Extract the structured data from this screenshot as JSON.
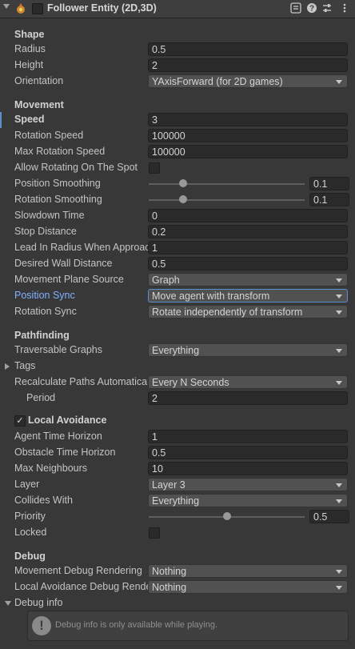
{
  "component": {
    "title": "Follower Entity (2D,3D)",
    "enabled": false
  },
  "sections": {
    "shape": "Shape",
    "movement": "Movement",
    "pathfinding": "Pathfinding",
    "local_avoidance": "Local Avoidance",
    "debug": "Debug"
  },
  "shape": {
    "radius": {
      "label": "Radius",
      "value": "0.5"
    },
    "height": {
      "label": "Height",
      "value": "2"
    },
    "orientation": {
      "label": "Orientation",
      "value": "YAxisForward (for 2D games)"
    }
  },
  "movement": {
    "speed": {
      "label": "Speed",
      "value": "3"
    },
    "rotation_speed": {
      "label": "Rotation Speed",
      "value": "100000"
    },
    "max_rotation_speed": {
      "label": "Max Rotation Speed",
      "value": "100000"
    },
    "allow_rotating": {
      "label": "Allow Rotating On The Spot",
      "checked": false
    },
    "position_smoothing": {
      "label": "Position Smoothing",
      "value": "0.1",
      "fraction": 0.22
    },
    "rotation_smoothing": {
      "label": "Rotation Smoothing",
      "value": "0.1",
      "fraction": 0.22
    },
    "slowdown_time": {
      "label": "Slowdown Time",
      "value": "0"
    },
    "stop_distance": {
      "label": "Stop Distance",
      "value": "0.2"
    },
    "lead_in_radius": {
      "label": "Lead In Radius When Approaching",
      "value": "1"
    },
    "desired_wall_distance": {
      "label": "Desired Wall Distance",
      "value": "0.5"
    },
    "movement_plane_source": {
      "label": "Movement Plane Source",
      "value": "Graph"
    },
    "position_sync": {
      "label": "Position Sync",
      "value": "Move agent with transform"
    },
    "rotation_sync": {
      "label": "Rotation Sync",
      "value": "Rotate independently of transform"
    }
  },
  "pathfinding": {
    "traversable_graphs": {
      "label": "Traversable Graphs",
      "value": "Everything"
    },
    "tags": {
      "label": "Tags"
    },
    "recalculate": {
      "label": "Recalculate Paths Automatically",
      "value": "Every N Seconds"
    },
    "period": {
      "label": "Period",
      "value": "2"
    }
  },
  "local_avoidance": {
    "enabled": true,
    "agent_time_horizon": {
      "label": "Agent Time Horizon",
      "value": "1"
    },
    "obstacle_time_horizon": {
      "label": "Obstacle Time Horizon",
      "value": "0.5"
    },
    "max_neighbours": {
      "label": "Max Neighbours",
      "value": "10"
    },
    "layer": {
      "label": "Layer",
      "value": "Layer 3"
    },
    "collides_with": {
      "label": "Collides With",
      "value": "Everything"
    },
    "priority": {
      "label": "Priority",
      "value": "0.5",
      "fraction": 0.5
    },
    "locked": {
      "label": "Locked",
      "checked": false
    }
  },
  "debug": {
    "movement_debug": {
      "label": "Movement Debug Rendering",
      "value": "Nothing"
    },
    "local_avoidance_debug": {
      "label": "Local Avoidance Debug Rendering",
      "value": "Nothing"
    },
    "debug_info": {
      "label": "Debug info"
    },
    "help": "Debug info is only available while playing."
  },
  "icons": {
    "component": "follower-entity-icon",
    "preset": "preset-icon",
    "help": "help-icon",
    "settings": "settings-icon",
    "menu": "more-menu-icon"
  },
  "colors": {
    "background": "#383838",
    "field": "#2a2a2a",
    "dropdown": "#515151",
    "accent": "#5d8ecf",
    "highlight_label": "#7fb1ff"
  }
}
